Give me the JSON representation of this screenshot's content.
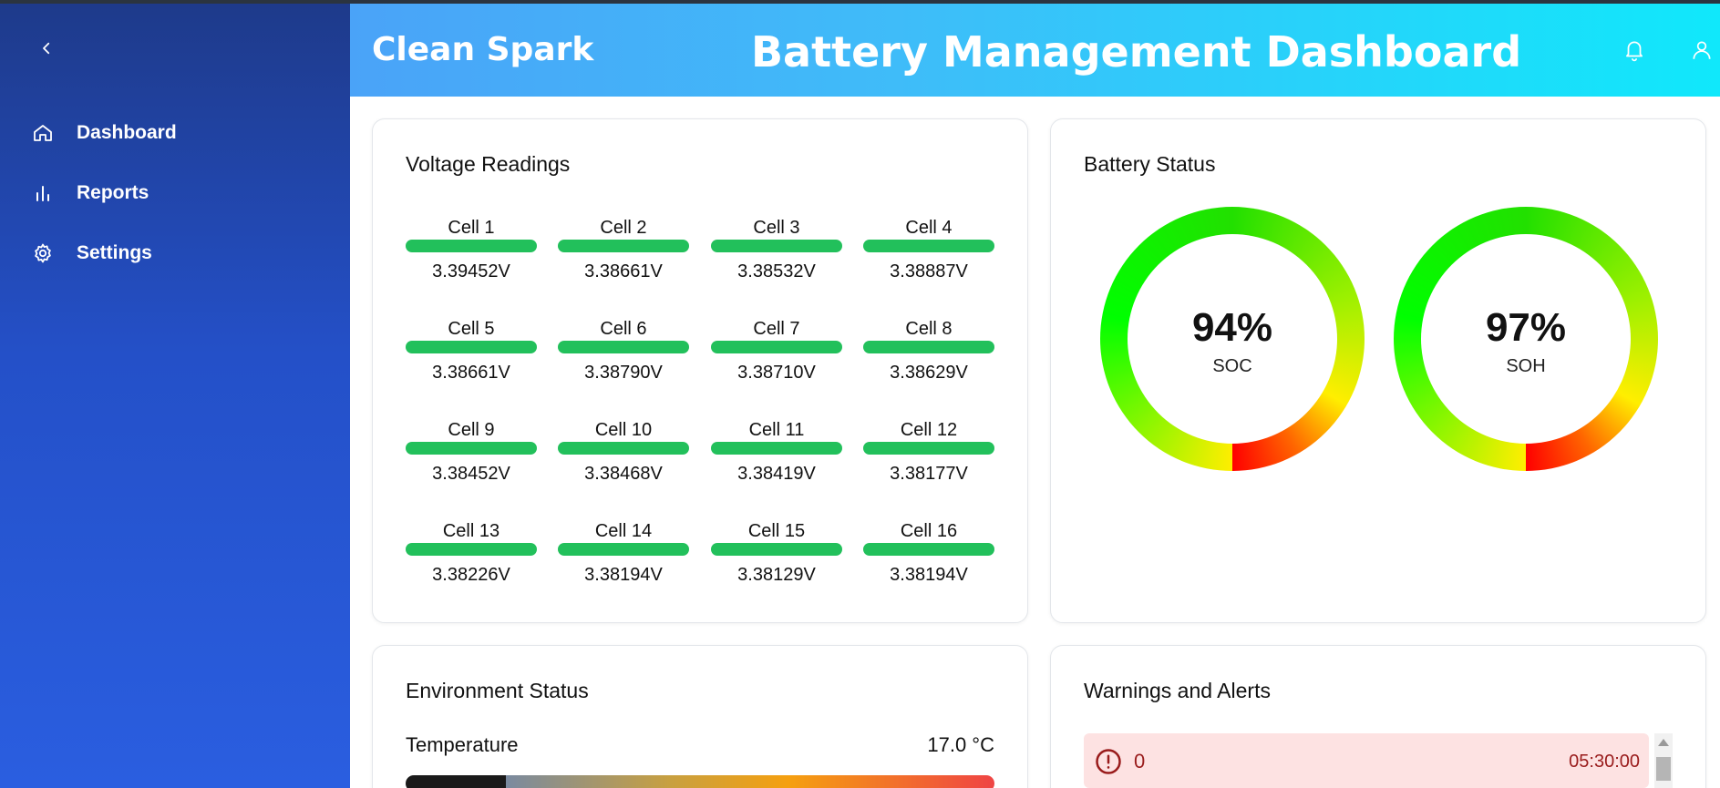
{
  "sidebar": {
    "items": [
      {
        "label": "Dashboard",
        "icon": "home-icon"
      },
      {
        "label": "Reports",
        "icon": "bar-chart-icon"
      },
      {
        "label": "Settings",
        "icon": "gear-icon"
      }
    ]
  },
  "header": {
    "brand": "Clean Spark",
    "title": "Battery Management Dashboard"
  },
  "voltage": {
    "title": "Voltage Readings",
    "cells": [
      {
        "name": "Cell 1",
        "value": "3.39452V"
      },
      {
        "name": "Cell 2",
        "value": "3.38661V"
      },
      {
        "name": "Cell 3",
        "value": "3.38532V"
      },
      {
        "name": "Cell 4",
        "value": "3.38887V"
      },
      {
        "name": "Cell 5",
        "value": "3.38661V"
      },
      {
        "name": "Cell 6",
        "value": "3.38790V"
      },
      {
        "name": "Cell 7",
        "value": "3.38710V"
      },
      {
        "name": "Cell 8",
        "value": "3.38629V"
      },
      {
        "name": "Cell 9",
        "value": "3.38452V"
      },
      {
        "name": "Cell 10",
        "value": "3.38468V"
      },
      {
        "name": "Cell 11",
        "value": "3.38419V"
      },
      {
        "name": "Cell 12",
        "value": "3.38177V"
      },
      {
        "name": "Cell 13",
        "value": "3.38226V"
      },
      {
        "name": "Cell 14",
        "value": "3.38194V"
      },
      {
        "name": "Cell 15",
        "value": "3.38129V"
      },
      {
        "name": "Cell 16",
        "value": "3.38194V"
      }
    ],
    "bar_color": "#22c05b"
  },
  "battery": {
    "title": "Battery Status",
    "soc": {
      "value": "94%",
      "label": "SOC"
    },
    "soh": {
      "value": "97%",
      "label": "SOH"
    }
  },
  "environment": {
    "title": "Environment Status",
    "temperature_label": "Temperature",
    "temperature_value": "17.0 °C"
  },
  "alerts": {
    "title": "Warnings and Alerts",
    "items": [
      {
        "message": "0",
        "time": "05:30:00"
      }
    ]
  },
  "colors": {
    "alert_bg": "#fde2e2",
    "alert_text": "#991b1b"
  }
}
